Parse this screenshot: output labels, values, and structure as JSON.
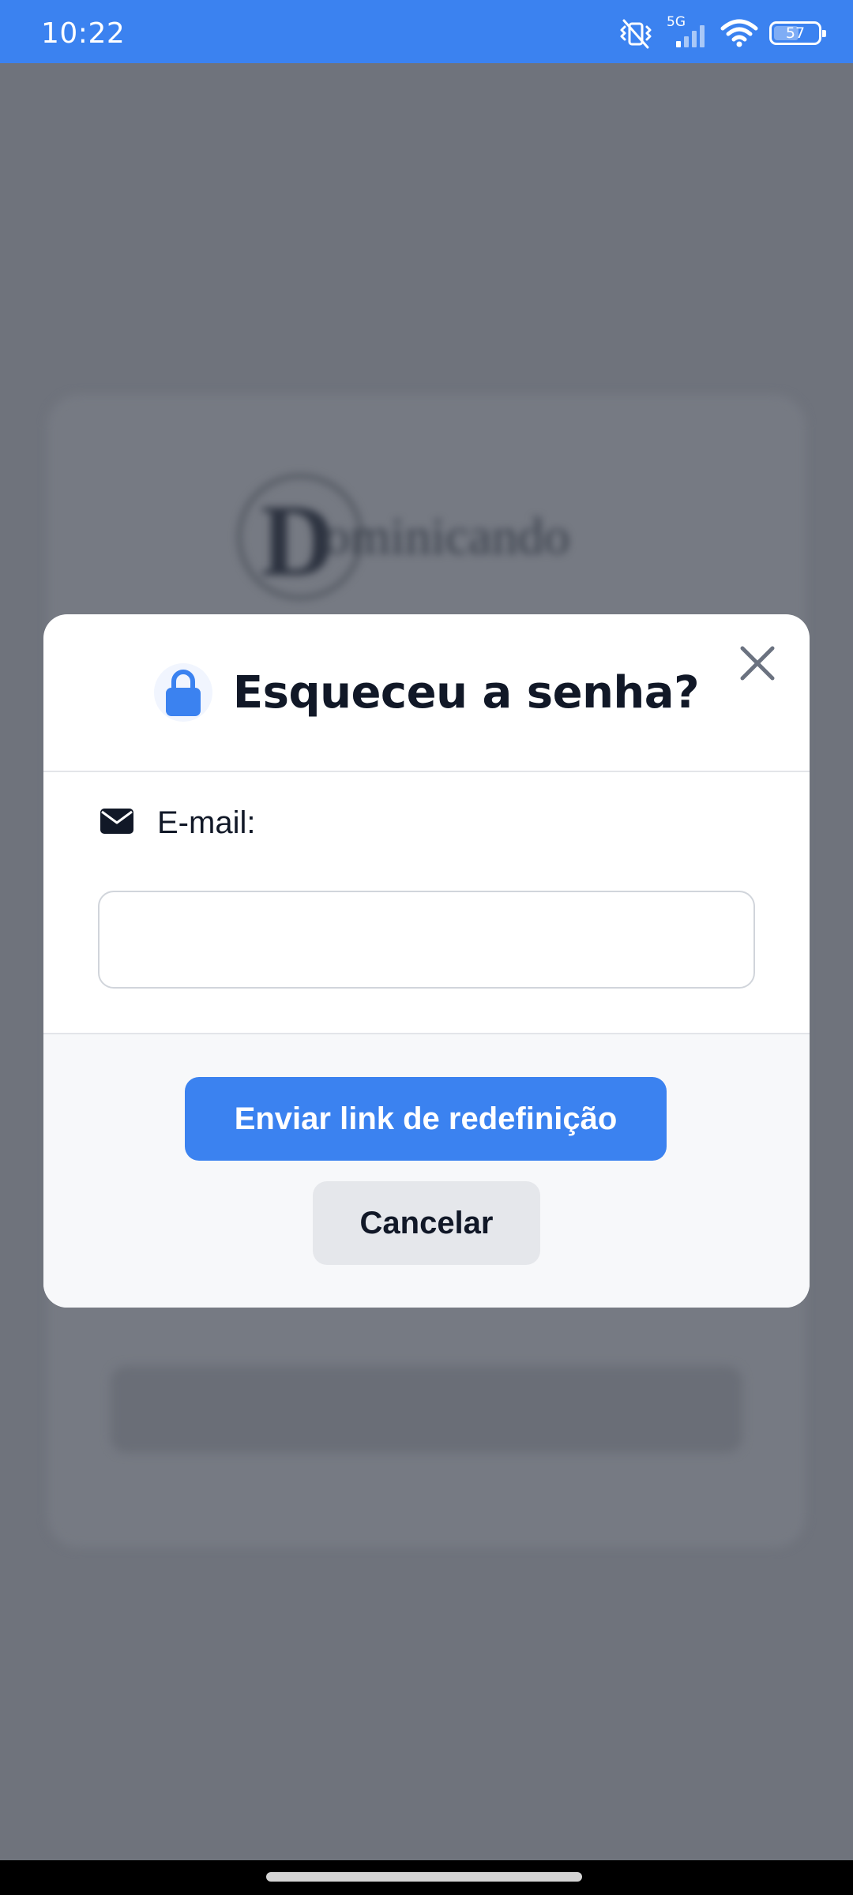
{
  "status_bar": {
    "time": "10:22",
    "network": "5G",
    "battery_level": "57",
    "battery_fraction": 0.57,
    "icons": [
      "vibrate-off-icon",
      "signal-5g-icon",
      "wifi-icon",
      "battery-icon"
    ]
  },
  "background": {
    "logo_letter": "D",
    "logo_text": "ominicando"
  },
  "modal": {
    "title": "Esqueceu a senha?",
    "title_icon": "lock-icon",
    "close_icon": "close-icon",
    "email_label": "E-mail:",
    "email_icon": "envelope-icon",
    "email_value": "",
    "email_placeholder": "",
    "submit_label": "Enviar link de redefinição",
    "cancel_label": "Cancelar"
  },
  "colors": {
    "accent": "#3b82f0",
    "overlay": "#6f737c",
    "title": "#111827",
    "secondary_button": "#e5e7eb"
  }
}
